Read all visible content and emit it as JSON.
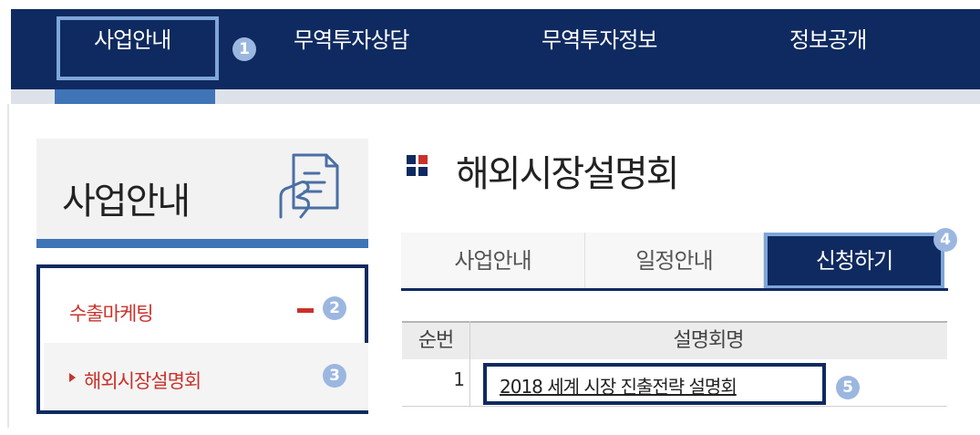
{
  "nav": {
    "items": [
      {
        "label": "사업안내"
      },
      {
        "label": "무역투자상담"
      },
      {
        "label": "무역투자정보"
      },
      {
        "label": "정보공개"
      }
    ]
  },
  "markers": [
    "1",
    "2",
    "3",
    "4",
    "5"
  ],
  "sidebar": {
    "title": "사업안내",
    "icon": "document-hand-icon",
    "menu": [
      {
        "label": "수출마케팅",
        "expanded": true
      },
      {
        "label": "해외시장설명회",
        "active": true
      }
    ]
  },
  "main": {
    "title": "해외시장설명회",
    "tabs": [
      {
        "label": "사업안내"
      },
      {
        "label": "일정안내"
      },
      {
        "label": "신청하기",
        "active": true
      }
    ],
    "table": {
      "columns": [
        "순번",
        "설명회명"
      ],
      "rows": [
        {
          "num": "1",
          "name": "2018 세계 시장 진출전략 설명회"
        }
      ]
    }
  },
  "colors": {
    "nav_bg": "#0f2a60",
    "accent": "#3f74b7",
    "highlight": "#7fa6d8",
    "marker": "#9bb7e0",
    "menu_text": "#c9322b"
  }
}
